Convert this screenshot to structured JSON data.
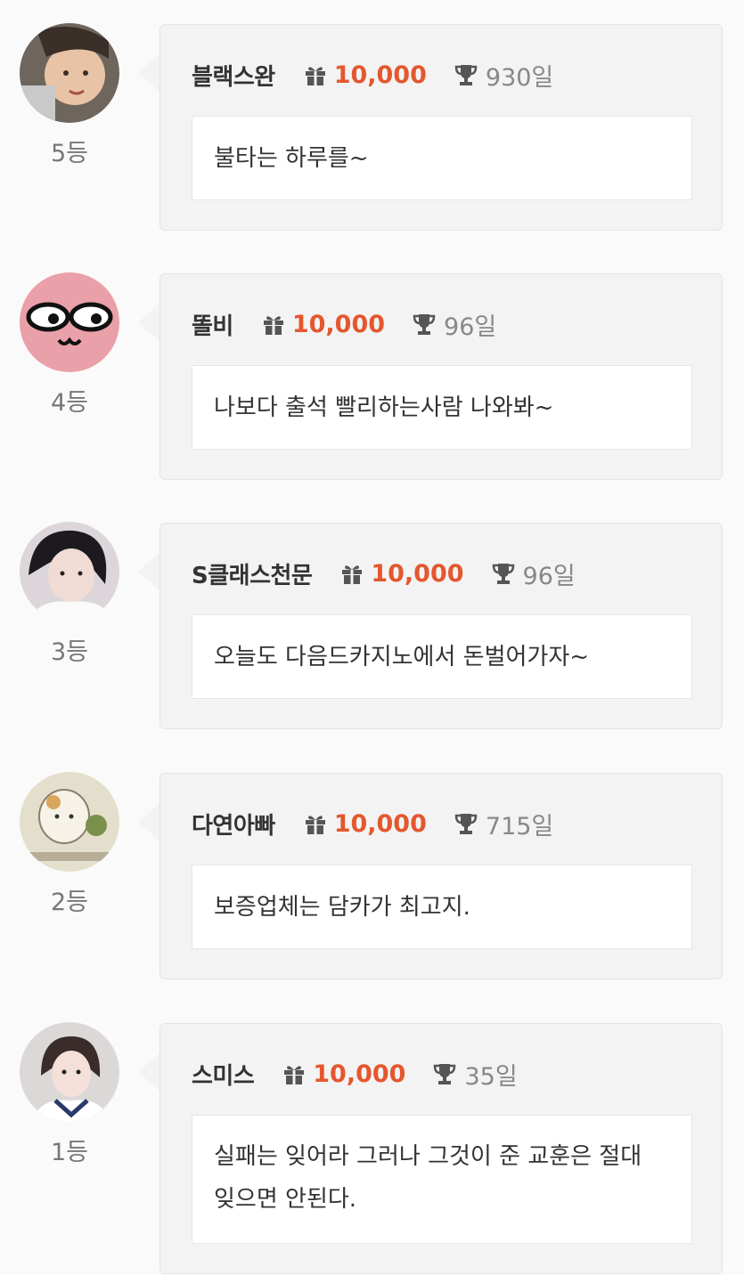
{
  "colors": {
    "accent": "#e4572e",
    "name": "#333333",
    "muted": "#888888",
    "card_bg": "#f3f3f3"
  },
  "icons": {
    "amount": "gift-icon",
    "days": "trophy-icon"
  },
  "entries": [
    {
      "rank": "5등",
      "name": "블랙스완",
      "amount": "10,000",
      "days": "930일",
      "message": "불타는 하루를~",
      "avatar_color": "#8a7a6a"
    },
    {
      "rank": "4등",
      "name": "똘비",
      "amount": "10,000",
      "days": "96일",
      "message": "나보다 출석 빨리하는사람 나와봐~",
      "avatar_color": "#eaa0a8"
    },
    {
      "rank": "3등",
      "name": "S클래스천문",
      "amount": "10,000",
      "days": "96일",
      "message": "오늘도 다음드카지노에서 돈벌어가자~",
      "avatar_color": "#d8d2d6"
    },
    {
      "rank": "2등",
      "name": "다연아빠",
      "amount": "10,000",
      "days": "715일",
      "message": "보증업체는 담카가 최고지.",
      "avatar_color": "#e2ddc9"
    },
    {
      "rank": "1등",
      "name": "스미스",
      "amount": "10,000",
      "days": "35일",
      "message": "실패는 잊어라 그러나 그것이 준 교훈은 절대 잊으면 안된다.",
      "avatar_color": "#d9d4d4"
    }
  ]
}
